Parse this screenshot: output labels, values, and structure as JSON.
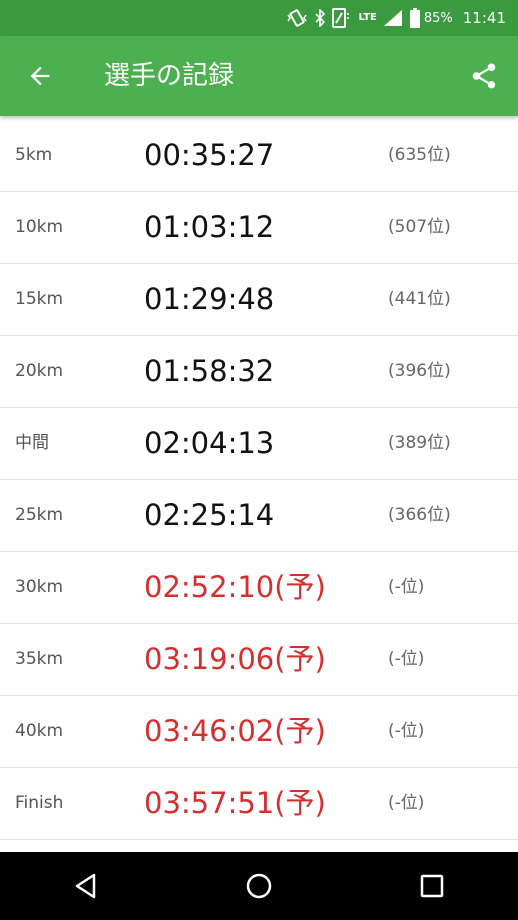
{
  "status": {
    "network": "LTE",
    "battery_percent": "85%",
    "time": "11:41"
  },
  "toolbar": {
    "title": "選手の記録"
  },
  "splits": [
    {
      "point": "5km",
      "time": "00:35:27",
      "rank": "(635位)",
      "predicted": false
    },
    {
      "point": "10km",
      "time": "01:03:12",
      "rank": "(507位)",
      "predicted": false
    },
    {
      "point": "15km",
      "time": "01:29:48",
      "rank": "(441位)",
      "predicted": false
    },
    {
      "point": "20km",
      "time": "01:58:32",
      "rank": "(396位)",
      "predicted": false
    },
    {
      "point": "中間",
      "time": "02:04:13",
      "rank": "(389位)",
      "predicted": false
    },
    {
      "point": "25km",
      "time": "02:25:14",
      "rank": "(366位)",
      "predicted": false
    },
    {
      "point": "30km",
      "time": "02:52:10(予)",
      "rank": "(-位)",
      "predicted": true
    },
    {
      "point": "35km",
      "time": "03:19:06(予)",
      "rank": "(-位)",
      "predicted": true
    },
    {
      "point": "40km",
      "time": "03:46:02(予)",
      "rank": "(-位)",
      "predicted": true
    },
    {
      "point": "Finish",
      "time": "03:57:51(予)",
      "rank": "(-位)",
      "predicted": true
    }
  ],
  "colors": {
    "app_bar": "#4caf50",
    "status_bar": "#3b9a3f",
    "predicted_time": "#d32f2f"
  }
}
